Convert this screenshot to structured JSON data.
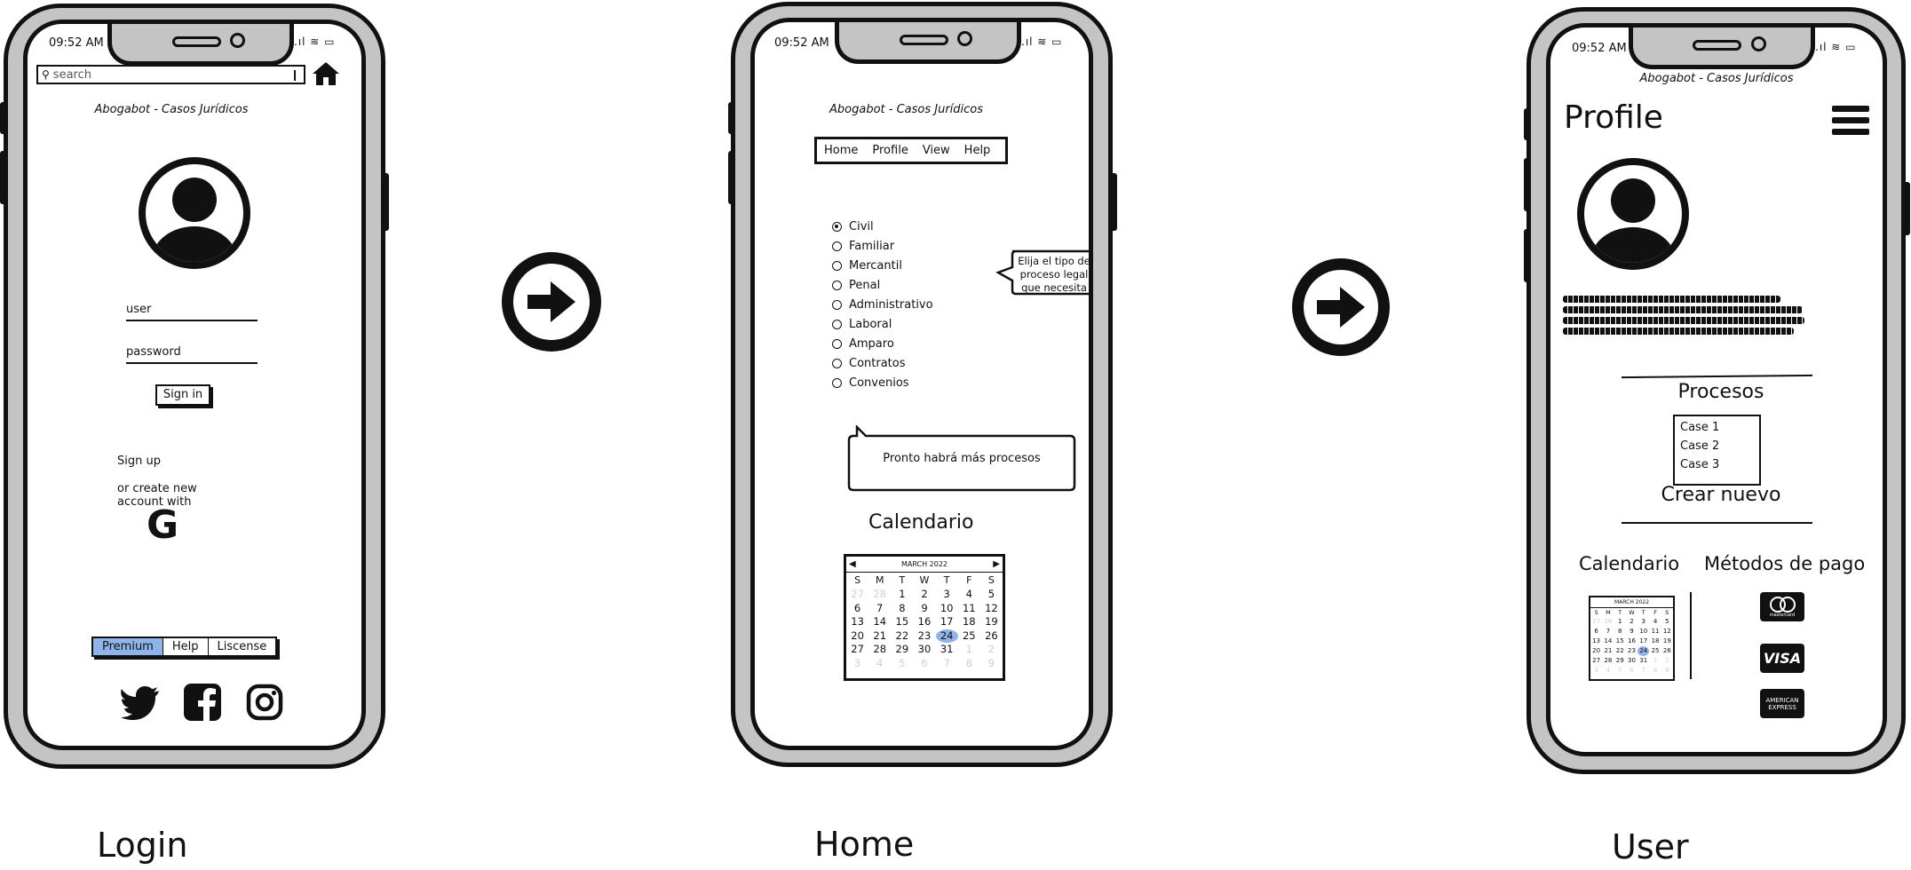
{
  "status_time": "09:52 AM",
  "screens": {
    "login": {
      "search_placeholder": "search",
      "app_title": "Abogabot - Casos Jurídicos",
      "user_label": "user",
      "password_label": "password",
      "signin_label": "Sign in",
      "signup_label": "Sign up",
      "create_account_label": "or create new account with",
      "bottom_tabs": [
        "Premium",
        "Help",
        "Liscense"
      ],
      "social_icons": [
        "twitter-icon",
        "facebook-icon",
        "instagram-icon"
      ]
    },
    "home": {
      "app_title": "Abogabot - Casos Jurídicos",
      "nav": [
        "Home",
        "Profile",
        "View",
        "Help"
      ],
      "case_types": [
        "Civil",
        "Familiar",
        "Mercantil",
        "Penal",
        "Administrativo",
        "Laboral",
        "Amparo",
        "Contratos",
        "Convenios"
      ],
      "selected_case_type": "Civil",
      "tooltip": "Elija el tipo de proceso legal que necesita",
      "note": "Pronto habrá más procesos",
      "calendar_title": "Calendario",
      "calendar": {
        "month": "MARCH 2022",
        "weekdays": [
          "S",
          "M",
          "T",
          "W",
          "T",
          "F",
          "S"
        ],
        "days": [
          "27",
          "28",
          "1",
          "2",
          "3",
          "4",
          "5",
          "6",
          "7",
          "8",
          "9",
          "10",
          "11",
          "12",
          "13",
          "14",
          "15",
          "16",
          "17",
          "18",
          "19",
          "20",
          "21",
          "22",
          "23",
          "24",
          "25",
          "26",
          "27",
          "28",
          "29",
          "30",
          "31",
          "1",
          "2",
          "3",
          "4",
          "5",
          "6",
          "7",
          "8",
          "9"
        ],
        "highlight": "24"
      }
    },
    "user": {
      "app_title": "Abogabot - Casos Jurídicos",
      "profile_title": "Profile",
      "procesos_title": "Procesos",
      "cases": [
        "Case 1",
        "Case 2",
        "Case 3"
      ],
      "create_new": "Crear nuevo",
      "calendar_title": "Calendario",
      "payment_title": "Métodos de pago",
      "payment_methods": [
        "mastercard",
        "VISA",
        "AMERICAN EXPRESS"
      ]
    }
  },
  "captions": [
    "Login",
    "Home",
    "User"
  ],
  "colors": {
    "accent": "#8fb4ea",
    "frame": "#c4c4c4",
    "ink": "#111111"
  }
}
